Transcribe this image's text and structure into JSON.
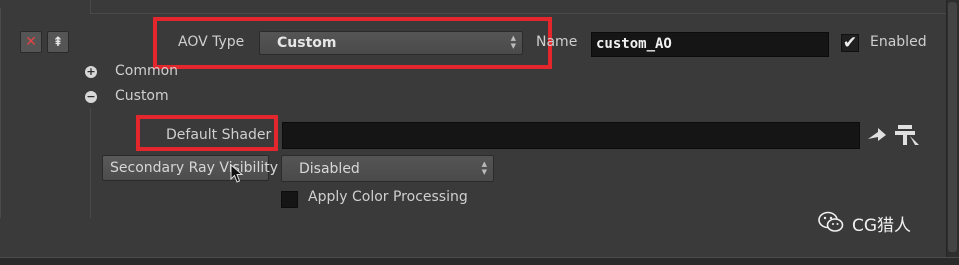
{
  "aov": {
    "type_label": "AOV Type",
    "type_value": "Custom",
    "name_label": "Name",
    "name_value": "custom_AO",
    "enabled_label": "Enabled",
    "enabled": true
  },
  "row_buttons": {
    "remove_glyph": "✕",
    "move_glyph": "⇞"
  },
  "groups": [
    {
      "label": "Common",
      "expanded": false,
      "icon": "plus-circle-icon"
    },
    {
      "label": "Custom",
      "expanded": true,
      "icon": "minus-circle-icon"
    }
  ],
  "custom": {
    "default_shader_label": "Default Shader",
    "default_shader_value": "",
    "secondary_ray_visibility_label": "Secondary Ray Visibility",
    "secondary_ray_visibility_value": "Disabled",
    "apply_color_processing_label": "Apply Color Processing",
    "apply_color_processing": false
  },
  "watermark": {
    "text": "CG猎人",
    "icon": "wechat-icon"
  },
  "colors": {
    "highlight": "#e3272c",
    "background": "#3a3a3a"
  }
}
